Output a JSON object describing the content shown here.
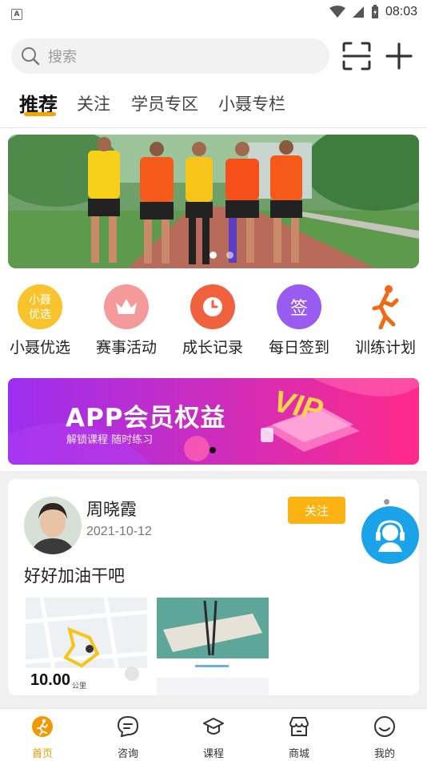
{
  "status_bar": {
    "time": "08:03",
    "badge_letter": "A"
  },
  "search": {
    "placeholder": "搜索"
  },
  "tabs": [
    {
      "label": "推荐",
      "active": true
    },
    {
      "label": "关注",
      "active": false
    },
    {
      "label": "学员专区",
      "active": false
    },
    {
      "label": "小聂专栏",
      "active": false
    }
  ],
  "banner": {
    "slide_count": 2,
    "active_slide": 1
  },
  "quick_menu": [
    {
      "label": "小聂优选",
      "icon_text": "小聂\n优选",
      "icon": "xiaonie-select-icon",
      "color": "#f7c52b"
    },
    {
      "label": "赛事活动",
      "icon": "crown-icon",
      "color": "#f47b7b"
    },
    {
      "label": "成长记录",
      "icon": "clock-icon",
      "color": "#f0623e"
    },
    {
      "label": "每日签到",
      "icon_text": "签",
      "icon": "sign-in-icon",
      "color": "#9a5cf0"
    },
    {
      "label": "训练计划",
      "icon": "runner-icon",
      "color": "#f06a14"
    }
  ],
  "vip_banner": {
    "title": "APP会员权益",
    "subtitle": "解锁课程  随时练习",
    "badge": "VIP"
  },
  "post": {
    "author": "周晓霞",
    "date": "2021-10-12",
    "follow_label": "关注",
    "text": "好好加油干吧",
    "distance": "10.00",
    "distance_unit": "公里"
  },
  "bottom_nav": [
    {
      "label": "首页",
      "icon": "home-runner-icon",
      "active": true
    },
    {
      "label": "咨询",
      "icon": "chat-icon",
      "active": false
    },
    {
      "label": "课程",
      "icon": "graduation-cap-icon",
      "active": false
    },
    {
      "label": "商城",
      "icon": "store-icon",
      "active": false
    },
    {
      "label": "我的",
      "icon": "profile-icon",
      "active": false
    }
  ],
  "colors": {
    "accent": "#f7a300",
    "follow_button": "#fbb314",
    "support_fab": "#1aa3e8",
    "vip_gradient_start": "#9b2ff0",
    "vip_gradient_end": "#ff2a8a"
  }
}
